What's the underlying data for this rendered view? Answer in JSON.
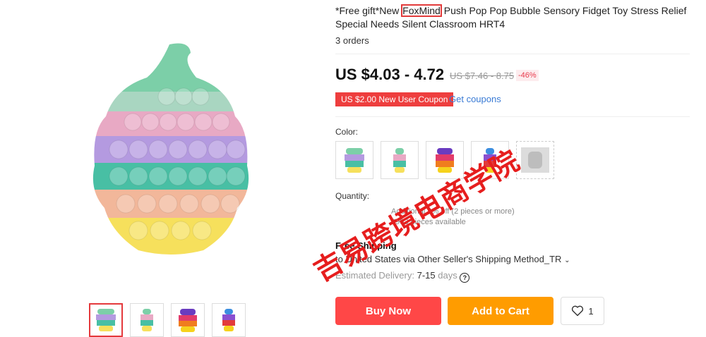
{
  "product": {
    "title_before": "*Free gift*New ",
    "title_brand": "FoxMind",
    "title_after": " Push Pop Pop Bubble Sensory Fidget Toy Stress Relief Special Needs Silent Classroom HRT4",
    "orders": "3 orders",
    "price": "US $4.03 - 4.72",
    "original_price": "US $7.46 - 8.75",
    "discount": "-46%",
    "coupon_label": "US $2.00 New User Coupon",
    "get_coupons": "Get coupons"
  },
  "options": {
    "color_label": "Color:",
    "swatches": [
      "cupcake-pastel",
      "cupcake-small",
      "cupcake-dark",
      "cupcake-rainbow",
      "cupcake-gray"
    ],
    "quantity_label": "Quantity:",
    "quantity_note": "Additional 3% off (2 pieces or more)",
    "pieces_available": "3993 pieces available"
  },
  "shipping": {
    "free_label": "Free Shipping",
    "ship_to": "to United States via Other Seller's Shipping Method_TR",
    "est_label": "Estimated Delivery:",
    "est_value": "7-15",
    "est_unit": "days"
  },
  "actions": {
    "buy_now": "Buy Now",
    "add_to_cart": "Add to Cart",
    "wishlist_count": "1"
  },
  "watermark": "吉易跨境电商学院",
  "colors": {
    "accent": "#ff4747",
    "cart": "#ff9c00",
    "link": "#3a7bd5"
  }
}
